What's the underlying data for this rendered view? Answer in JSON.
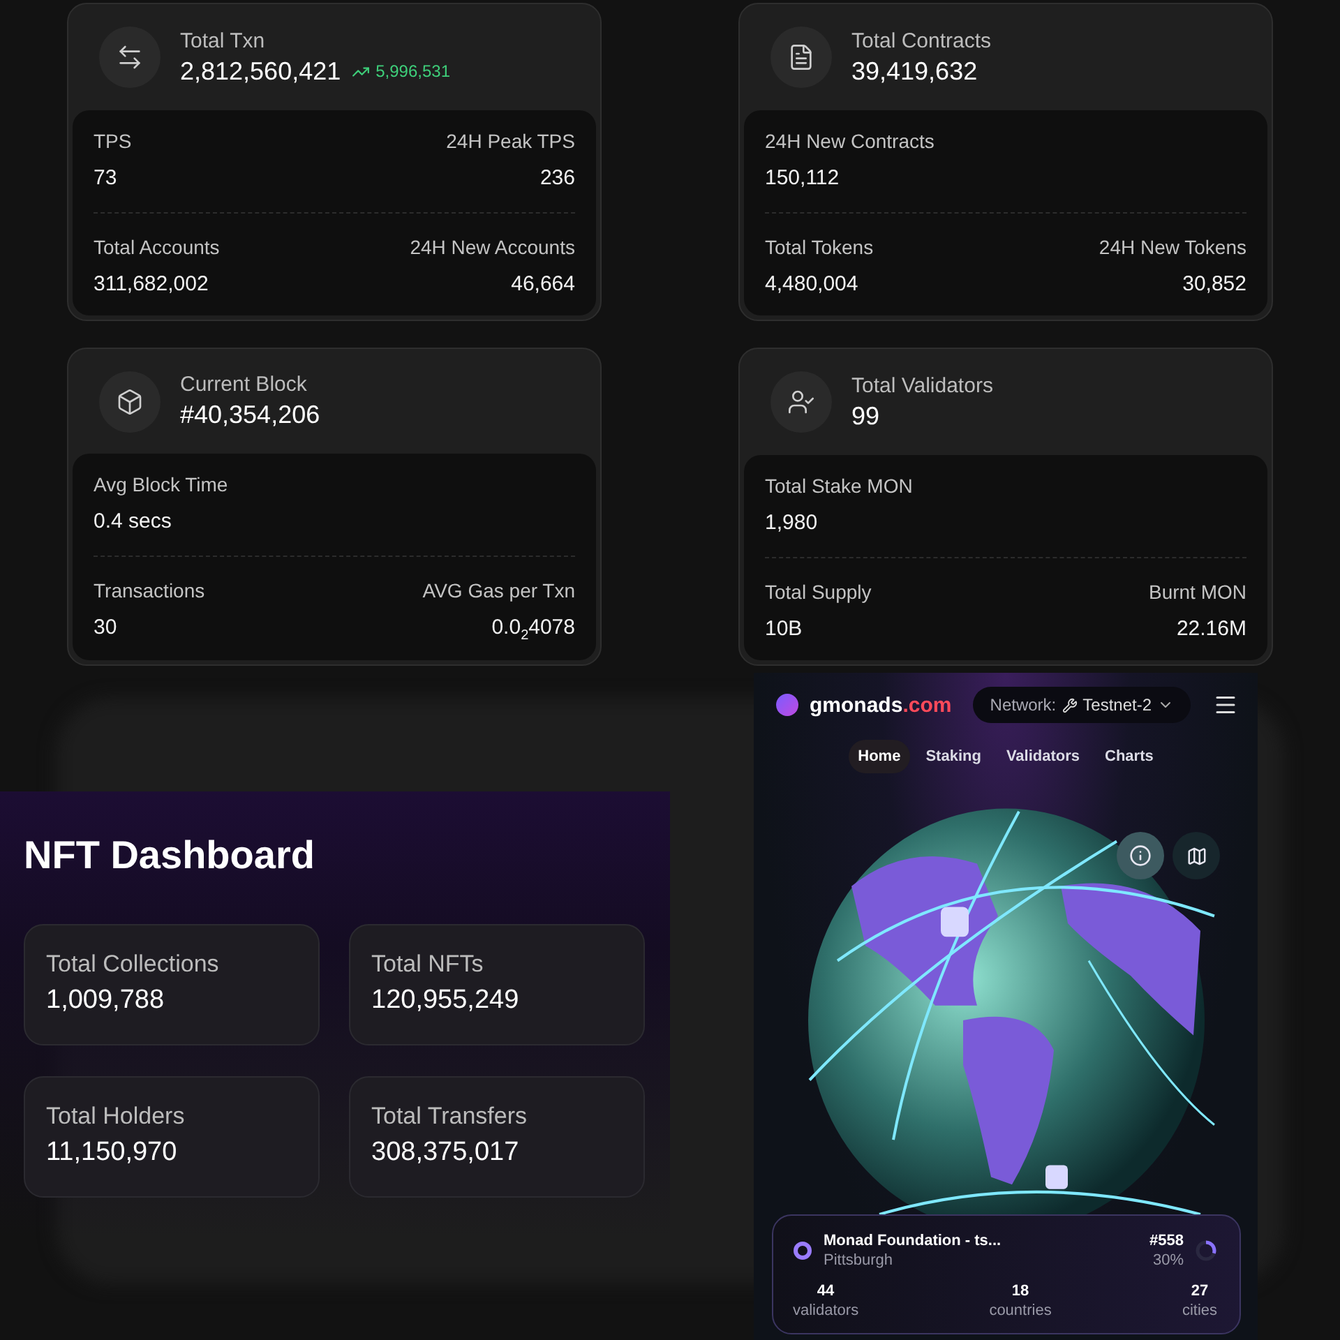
{
  "stat_cards": [
    {
      "title": "Total Txn",
      "value": "2,812,560,421",
      "change": "5,996,531",
      "rows": [
        [
          {
            "label": "TPS",
            "value": "73"
          },
          {
            "label": "24H Peak TPS",
            "value": "236"
          }
        ],
        [
          {
            "label": "Total Accounts",
            "value": "311,682,002"
          },
          {
            "label": "24H New Accounts",
            "value": "46,664"
          }
        ]
      ]
    },
    {
      "title": "Total Contracts",
      "value": "39,419,632",
      "rows": [
        [
          {
            "label": "24H New Contracts",
            "value": "150,112"
          }
        ],
        [
          {
            "label": "Total Tokens",
            "value": "4,480,004"
          },
          {
            "label": "24H New Tokens",
            "value": "30,852"
          }
        ]
      ]
    },
    {
      "title": "Current Block",
      "value": "#40,354,206",
      "rows": [
        [
          {
            "label": "Avg Block Time",
            "value": "0.4 secs"
          }
        ],
        [
          {
            "label": "Transactions",
            "value": "30"
          },
          {
            "label": "AVG Gas per Txn",
            "value": "0.0$_{2}$4078"
          }
        ]
      ]
    },
    {
      "title": "Total Validators",
      "value": "99",
      "rows": [
        [
          {
            "label": "Total Stake MON",
            "value": "1,980"
          }
        ],
        [
          {
            "label": "Total Supply",
            "value": "10B"
          },
          {
            "label": "Burnt MON",
            "value": "22.16M"
          }
        ]
      ]
    }
  ],
  "nft_dashboard": {
    "title": "NFT Dashboard",
    "cards": [
      {
        "label": "Total Collections",
        "value": "1,009,788"
      },
      {
        "label": "Total NFTs",
        "value": "120,955,249"
      },
      {
        "label": "Total Holders",
        "value": "11,150,970"
      },
      {
        "label": "Total Transfers",
        "value": "308,375,017"
      }
    ]
  },
  "explorer": {
    "logo": {
      "name": "gmonads",
      "suffix": ".com"
    },
    "network": {
      "label": "Network:",
      "value": "Testnet-2"
    },
    "nav": [
      {
        "label": "Home",
        "selected": true
      },
      {
        "label": "Staking",
        "selected": false
      },
      {
        "label": "Validators",
        "selected": false
      },
      {
        "label": "Charts",
        "selected": false
      }
    ],
    "validator": {
      "name": "Monad Foundation - ts...",
      "city": "Pittsburgh",
      "rank": "#558",
      "share": "30%",
      "level": 0.3,
      "stats": [
        {
          "value": "44",
          "label": "validators"
        },
        {
          "value": "18",
          "label": "countries"
        },
        {
          "value": "27",
          "label": "cities"
        }
      ]
    }
  }
}
